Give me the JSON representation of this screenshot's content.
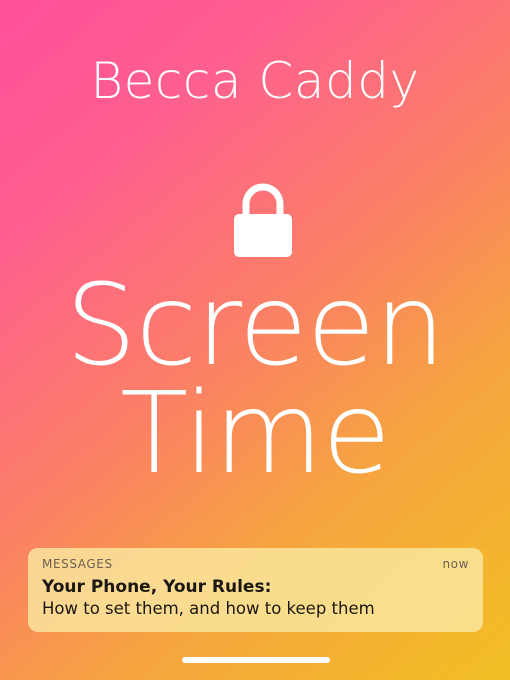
{
  "cover": {
    "author": "Becca Caddy",
    "title_line1": "Screen",
    "title_line2": "Time",
    "icons": {
      "lock": "lock-icon"
    }
  },
  "notification": {
    "app": "MESSAGES",
    "time": "now",
    "title": "Your Phone, Your Rules:",
    "body": "How to set them, and how to keep them"
  },
  "colors": {
    "gradient_start": "#ff4f9a",
    "gradient_end": "#f2bf23",
    "text": "#ffffff"
  }
}
